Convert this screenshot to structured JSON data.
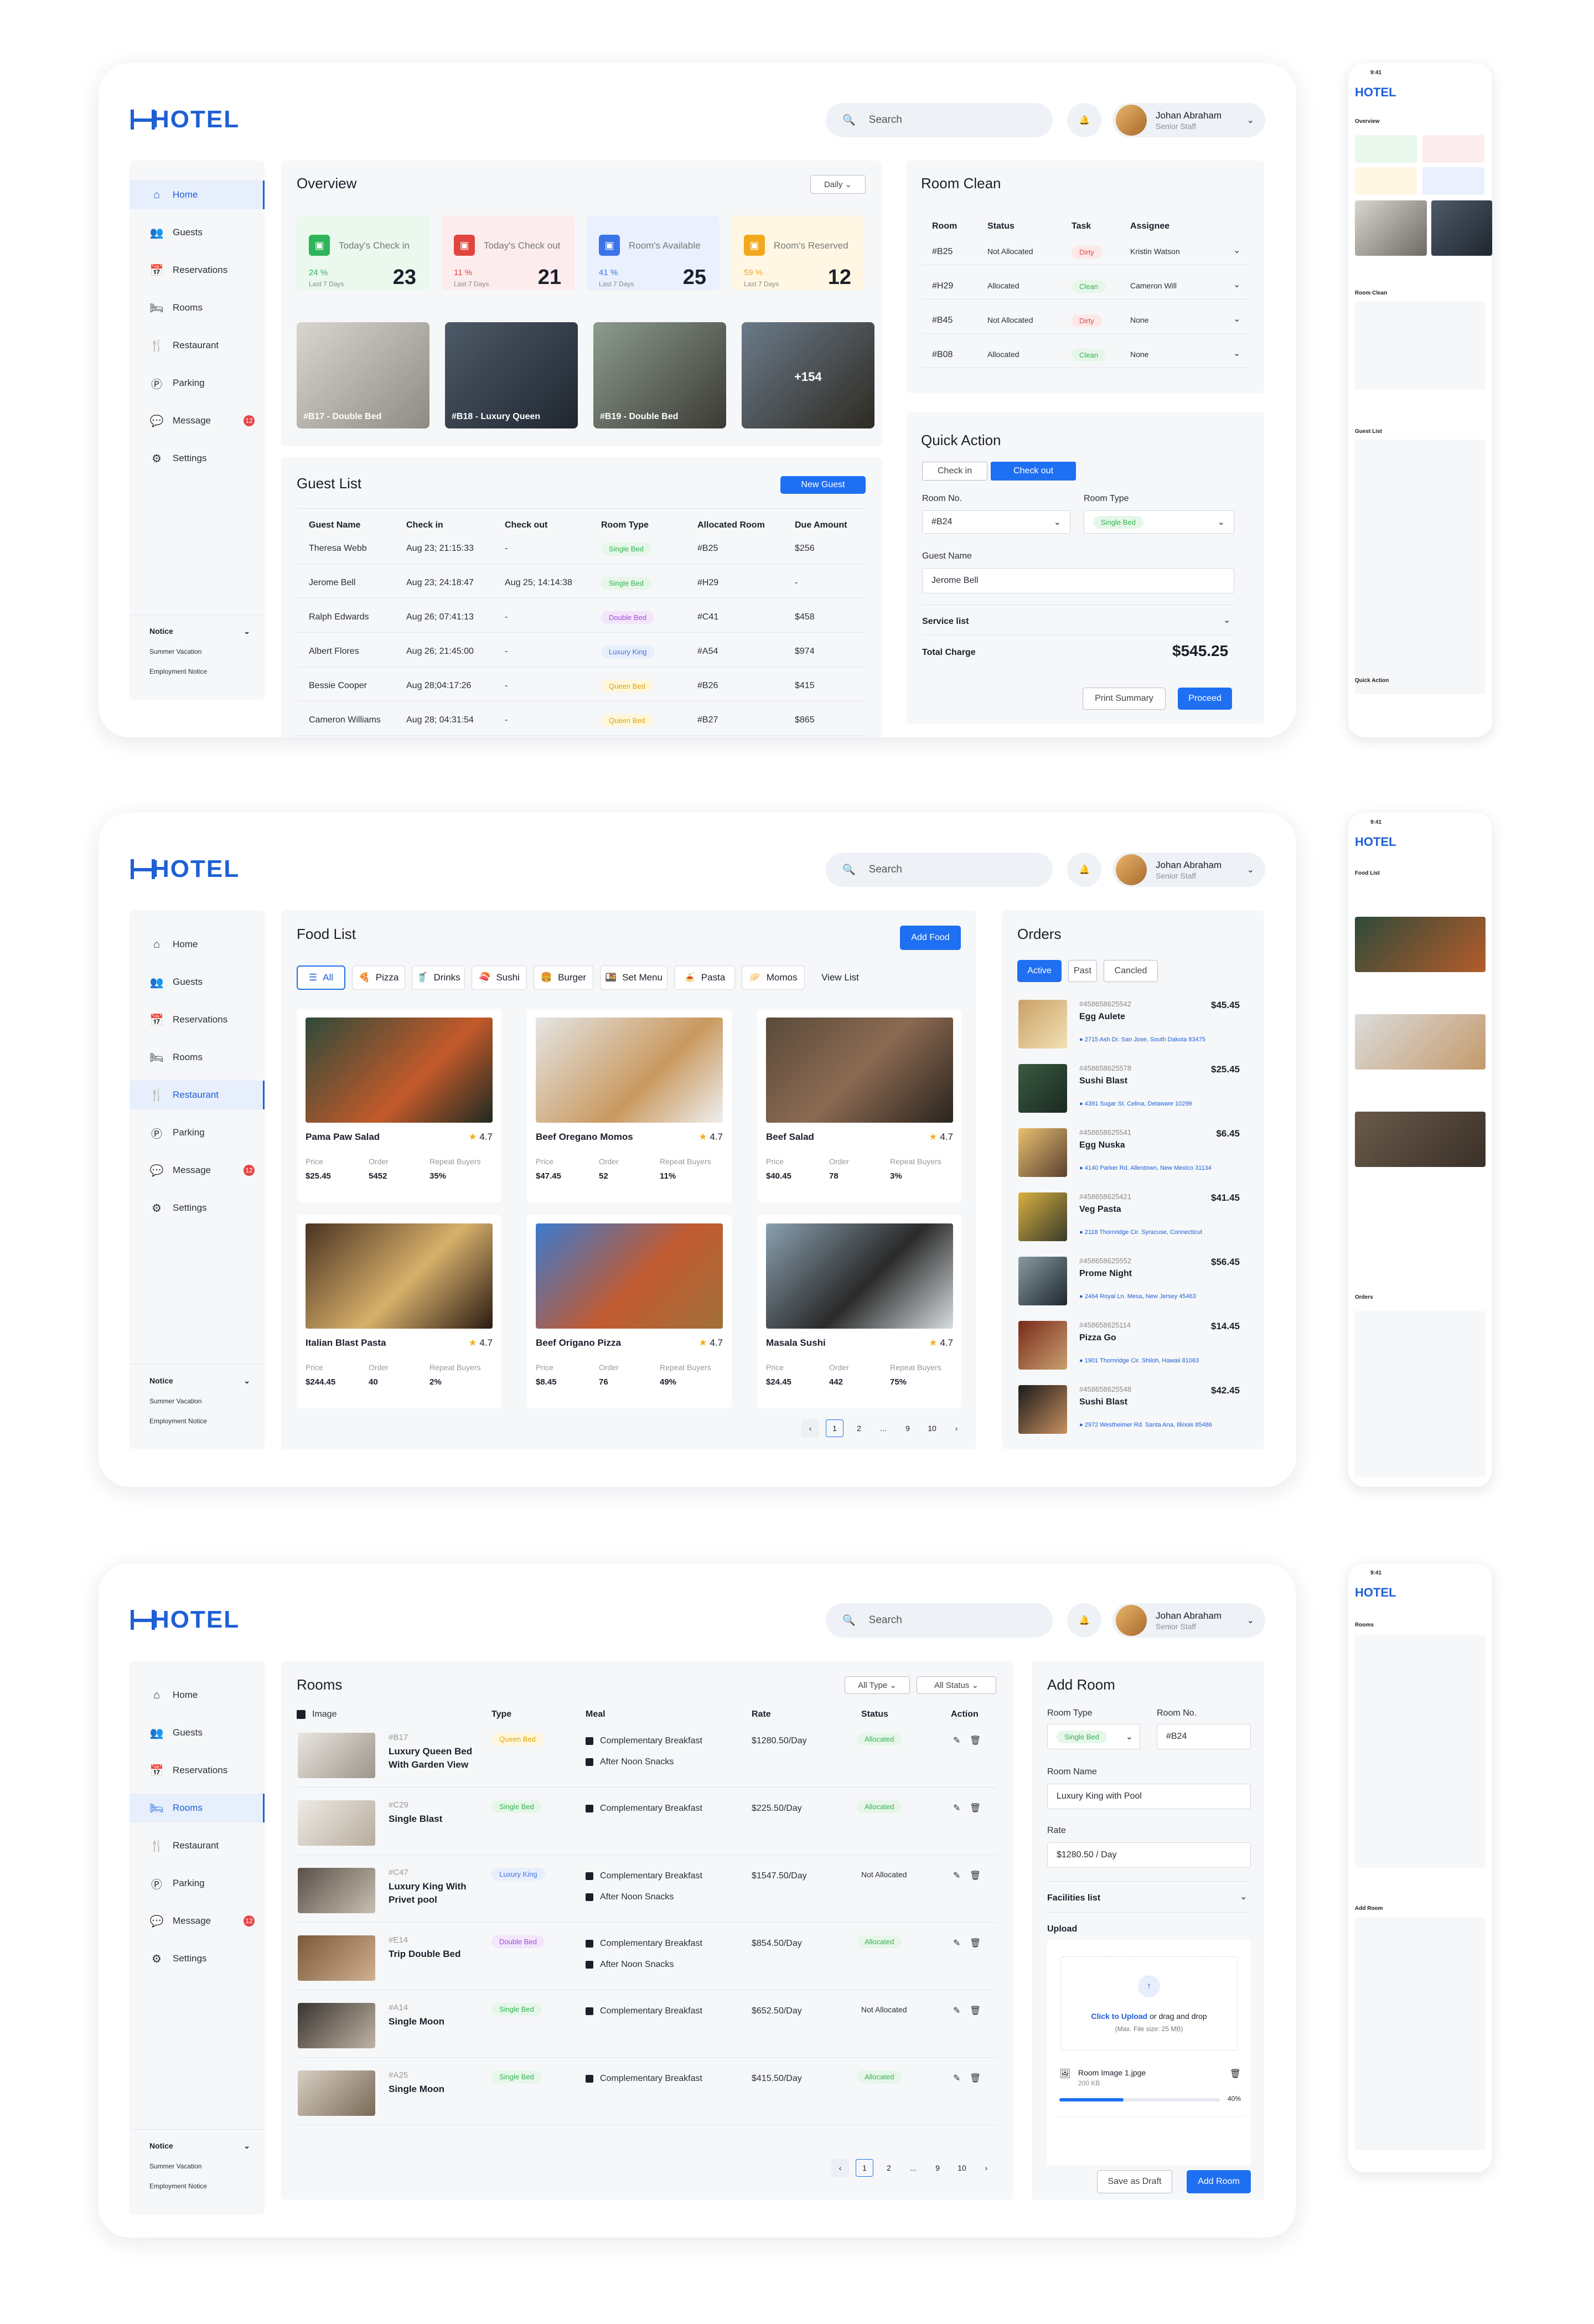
{
  "brand": {
    "name": "HOTEL",
    "color": "#1f5fd6"
  },
  "header": {
    "search_placeholder": "Search",
    "user_name": "Johan Abraham",
    "user_role": "Senior Staff"
  },
  "nav": [
    "Home",
    "Guests",
    "Reservations",
    "Rooms",
    "Restaurant",
    "Parking",
    "Message",
    "Settings"
  ],
  "nav_icons": [
    "home-icon",
    "guests-icon",
    "reservations-icon",
    "rooms-icon",
    "restaurant-icon",
    "parking-icon",
    "message-icon",
    "settings-icon"
  ],
  "message_badge": "12",
  "notice": {
    "title": "Notice",
    "items": [
      "Summer Vacation",
      "Employment Notice"
    ]
  },
  "dashboard": {
    "overview": {
      "title": "Overview",
      "period": "Daily",
      "stats": [
        {
          "label": "Today's Check in",
          "pct": "24 %",
          "sub": "Last 7 Days",
          "value": "23",
          "color": "#2fb45a",
          "bg": "#eaf8ee"
        },
        {
          "label": "Today's Check out",
          "pct": "11 %",
          "sub": "Last 7 Days",
          "value": "21",
          "color": "#e0453f",
          "bg": "#fdeced"
        },
        {
          "label": "Room's Available",
          "pct": "41 %",
          "sub": "Last 7 Days",
          "value": "25",
          "color": "#3b74e8",
          "bg": "#eaf0fd"
        },
        {
          "label": "Room's Reserved",
          "pct": "59 %",
          "sub": "Last 7 Days",
          "value": "12",
          "color": "#f2a81d",
          "bg": "#fff7e4"
        }
      ],
      "photos": [
        "#B17 - Double Bed",
        "#B18 - Luxury Queen",
        "#B19 - Double Bed",
        "+154"
      ]
    },
    "room_clean": {
      "title": "Room Clean",
      "headers": [
        "Room",
        "Status",
        "Task",
        "Assignee"
      ],
      "rows": [
        [
          "#B25",
          "Not Allocated",
          "Dirty",
          "Kristin Watson"
        ],
        [
          "#H29",
          "Allocated",
          "Clean",
          "Cameron Will"
        ],
        [
          "#B45",
          "Not Allocated",
          "Dirty",
          "None"
        ],
        [
          "#B08",
          "Allocated",
          "Clean",
          "None"
        ]
      ]
    },
    "guest_list": {
      "title": "Guest List",
      "new_label": "New Guest",
      "headers": [
        "Guest Name",
        "Check in",
        "Check out",
        "Room Type",
        "Allocated Room",
        "Due Amount"
      ],
      "rows": [
        [
          "Theresa Webb",
          "Aug 23; 21:15:33",
          "-",
          "Single Bed",
          "#B25",
          "$256"
        ],
        [
          "Jerome Bell",
          "Aug 23; 24:18:47",
          "Aug 25; 14:14:38",
          "Single Bed",
          "#H29",
          "-"
        ],
        [
          "Ralph Edwards",
          "Aug 26; 07:41:13",
          "-",
          "Double Bed",
          "#C41",
          "$458"
        ],
        [
          "Albert Flores",
          "Aug 26; 21:45:00",
          "-",
          "Luxury King",
          "#A54",
          "$974"
        ],
        [
          "Bessie Cooper",
          "Aug 28;04:17:26",
          "-",
          "Queen Bed",
          "#B26",
          "$415"
        ],
        [
          "Cameron Williams",
          "Aug 28; 04:31:54",
          "-",
          "Queen Bed",
          "#B27",
          "$865"
        ]
      ]
    },
    "quick_action": {
      "title": "Quick Action",
      "tab_in": "Check in",
      "tab_out": "Check out",
      "room_no_label": "Room No.",
      "room_no": "#B24",
      "room_type_label": "Room Type",
      "room_type": "Single Bed",
      "guest_label": "Guest Name",
      "guest": "Jerome Bell",
      "service": "Service list",
      "total_label": "Total Charge",
      "total": "$545.25",
      "print": "Print Summary",
      "proceed": "Proceed"
    }
  },
  "restaurant": {
    "title": "Food List",
    "add_label": "Add Food",
    "filters": [
      "All",
      "Pizza",
      "Drinks",
      "Sushi",
      "Burger",
      "Set Menu",
      "Pasta",
      "Momos",
      "View List"
    ],
    "foods": [
      {
        "name": "Pama Paw Salad",
        "rating": "4.7",
        "price": "$25.45",
        "order": "5452",
        "repeat": "35%"
      },
      {
        "name": "Beef Oregano Momos",
        "rating": "4.7",
        "price": "$47.45",
        "order": "52",
        "repeat": "11%"
      },
      {
        "name": "Beef Salad",
        "rating": "4.7",
        "price": "$40.45",
        "order": "78",
        "repeat": "3%"
      },
      {
        "name": "Italian Blast Pasta",
        "rating": "4.7",
        "price": "$244.45",
        "order": "40",
        "repeat": "2%"
      },
      {
        "name": "Beef Origano Pizza",
        "rating": "4.7",
        "price": "$8.45",
        "order": "76",
        "repeat": "49%"
      },
      {
        "name": "Masala Sushi",
        "rating": "4.7",
        "price": "$24.45",
        "order": "442",
        "repeat": "75%"
      }
    ],
    "food_labels": {
      "price": "Price",
      "order": "Order",
      "repeat": "Repeat Buyers"
    },
    "pagination": [
      "1",
      "2",
      "...",
      "9",
      "10"
    ],
    "orders": {
      "title": "Orders",
      "tabs": [
        "Active",
        "Past",
        "Cancled"
      ],
      "items": [
        {
          "id": "#458658625542",
          "name": "Egg Aulete",
          "price": "$45.45",
          "addr": "2715 Ash Dr. San Jose, South Dakota 83475"
        },
        {
          "id": "#458658625578",
          "name": "Sushi Blast",
          "price": "$25.45",
          "addr": "4391 Sugar St. Celina, Delaware 10299"
        },
        {
          "id": "#458658625541",
          "name": "Egg Nuska",
          "price": "$6.45",
          "addr": "4140 Parker Rd. Allentown, New Mexico 31134"
        },
        {
          "id": "#458658625421",
          "name": "Veg Pasta",
          "price": "$41.45",
          "addr": "2118 Thornridge Cir. Syracuse, Connecticut"
        },
        {
          "id": "#458658625552",
          "name": "Prome Night",
          "price": "$56.45",
          "addr": "2464 Royal Ln. Mesa, New Jersey 45463"
        },
        {
          "id": "#458658625114",
          "name": "Pizza Go",
          "price": "$14.45",
          "addr": "1901 Thornridge Cir. Shiloh, Hawaii 81063"
        },
        {
          "id": "#458658625548",
          "name": "Sushi Blast",
          "price": "$42.45",
          "addr": "2972 Westheimer Rd. Santa Ana, Illinois 85486"
        }
      ]
    }
  },
  "rooms": {
    "title": "Rooms",
    "filter_type": "All Type",
    "filter_status": "All Status",
    "headers": [
      "Image",
      "Type",
      "Meal",
      "Rate",
      "Status",
      "Action"
    ],
    "rows": [
      {
        "no": "#B17",
        "name": "Luxury Queen Bed With Garden View",
        "type": "Queen Bed",
        "meals": [
          "Complementary Breakfast",
          "After Noon Snacks"
        ],
        "rate": "$1280.50/Day",
        "status": "Allocated"
      },
      {
        "no": "#C29",
        "name": "Single Blast",
        "type": "Single Bed",
        "meals": [
          "Complementary Breakfast"
        ],
        "rate": "$225.50/Day",
        "status": "Allocated"
      },
      {
        "no": "#C47",
        "name": "Luxury King With Privet pool",
        "type": "Luxury King",
        "meals": [
          "Complementary Breakfast",
          "After Noon Snacks"
        ],
        "rate": "$1547.50/Day",
        "status": "Not Allocated"
      },
      {
        "no": "#E14",
        "name": "Trip Double Bed",
        "type": "Double Bed",
        "meals": [
          "Complementary Breakfast",
          "After Noon Snacks"
        ],
        "rate": "$854.50/Day",
        "status": "Allocated"
      },
      {
        "no": "#A14",
        "name": "Single Moon",
        "type": "Single Bed",
        "meals": [
          "Complementary Breakfast"
        ],
        "rate": "$652.50/Day",
        "status": "Not Allocated"
      },
      {
        "no": "#A25",
        "name": "Single Moon",
        "type": "Single Bed",
        "meals": [
          "Complementary Breakfast"
        ],
        "rate": "$415.50/Day",
        "status": "Allocated"
      }
    ],
    "pagination": [
      "1",
      "2",
      "...",
      "9",
      "10"
    ],
    "add_room": {
      "title": "Add Room",
      "type_label": "Room Type",
      "type": "Single Bed",
      "no_label": "Room No.",
      "no": "#B24",
      "name_label": "Room Name",
      "name": "Luxury King with Pool",
      "rate_label": "Rate",
      "rate": "$1280.50 / Day",
      "facilities": "Facilities list",
      "upload": "Upload",
      "upload_cta": "Click to Upload",
      "upload_rest": "or drag and drop",
      "upload_max": "(Max. File size: 25 MB)",
      "file_name": "Room Image 1.jpge",
      "file_size": "200 KB",
      "file_pct": "40%",
      "file_progress": 0.4,
      "draft": "Save as Draft",
      "add": "Add Room"
    }
  },
  "mobile": {
    "time": "9:41"
  }
}
